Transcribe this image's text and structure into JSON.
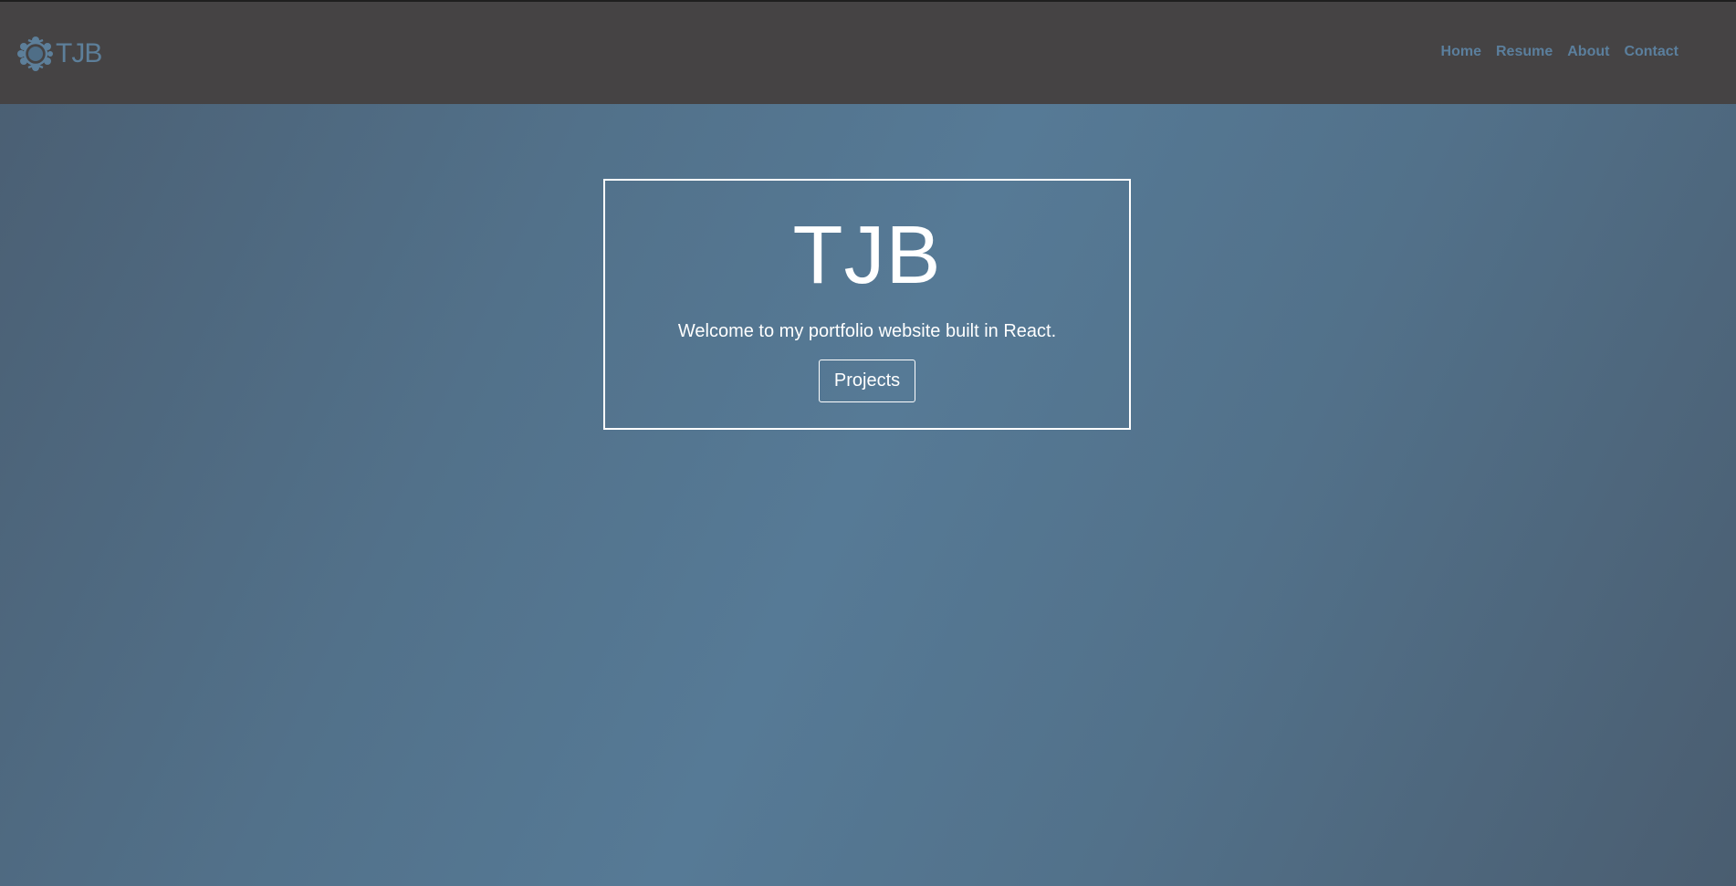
{
  "header": {
    "logo_text": "TJB",
    "logo_icon": "molecule-icon",
    "nav": [
      {
        "label": "Home"
      },
      {
        "label": "Resume"
      },
      {
        "label": "About"
      },
      {
        "label": "Contact"
      }
    ]
  },
  "hero": {
    "title": "TJB",
    "subtitle": "Welcome to my portfolio website built in React.",
    "button_label": "Projects"
  },
  "colors": {
    "header_bg": "#454344",
    "nav_link": "#5b7f9d",
    "background_mid": "#567a96",
    "hero_text": "#ffffff"
  }
}
